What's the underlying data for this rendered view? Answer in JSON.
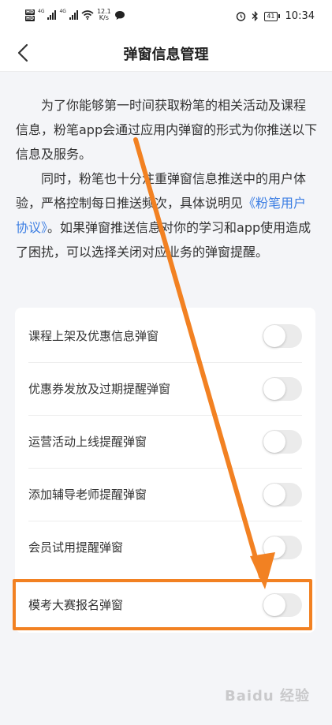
{
  "status_bar": {
    "hd_1": "HD",
    "hd_2": "HD",
    "net_1": "4G",
    "net_2": "4G",
    "speed_value": "12.1",
    "speed_unit": "K/s",
    "battery": "41",
    "time": "10:34"
  },
  "nav": {
    "back_glyph": "‹",
    "title": "弹窗信息管理"
  },
  "intro": {
    "para1": "为了你能够第一时间获取粉笔的相关活动及课程信息，粉笔app会通过应用内弹窗的形式为你推送以下信息及服务。",
    "para2_before": "同时，粉笔也十分注重弹窗信息推送中的用户体验，严格控制每日推送频次，具体说明见",
    "para2_link": "《粉笔用户协议》",
    "para2_after": "。如果弹窗推送信息对你的学习和app使用造成了困扰，可以选择关闭对应业务的弹窗提醒。"
  },
  "settings": {
    "items": [
      {
        "label": "课程上架及优惠信息弹窗",
        "enabled": false
      },
      {
        "label": "优惠券发放及过期提醒弹窗",
        "enabled": false
      },
      {
        "label": "运营活动上线提醒弹窗",
        "enabled": false
      },
      {
        "label": "添加辅导老师提醒弹窗",
        "enabled": false
      },
      {
        "label": "会员试用提醒弹窗",
        "enabled": false
      },
      {
        "label": "模考大赛报名弹窗",
        "enabled": false
      }
    ]
  },
  "annotation": {
    "color": "#f28122"
  },
  "watermark": "Baidu 经验"
}
